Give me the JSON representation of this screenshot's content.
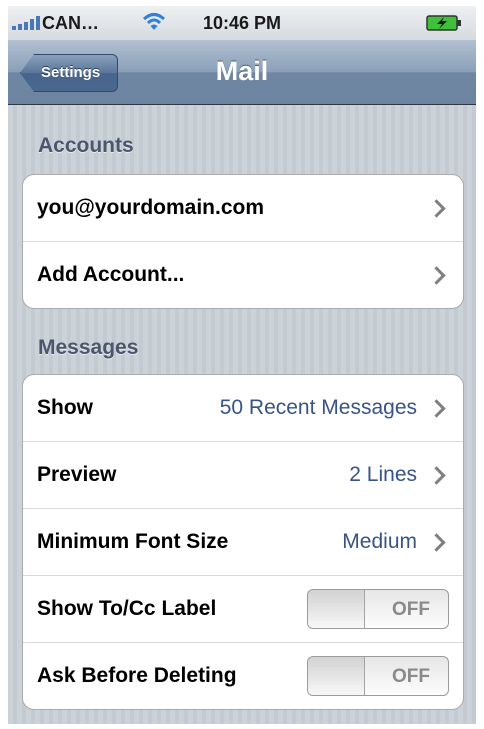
{
  "status_bar": {
    "carrier": "CAN…",
    "time": "10:46 PM",
    "icons": [
      "signal-bars-icon",
      "wifi-icon",
      "battery-charging-icon"
    ]
  },
  "nav": {
    "back_label": "Settings",
    "title": "Mail"
  },
  "accounts": {
    "header": "Accounts",
    "rows": [
      {
        "label": "you@yourdomain.com"
      },
      {
        "label": "Add Account..."
      }
    ]
  },
  "messages": {
    "header": "Messages",
    "show": {
      "label": "Show",
      "value": "50 Recent Messages"
    },
    "preview": {
      "label": "Preview",
      "value": "2 Lines"
    },
    "min_font": {
      "label": "Minimum Font Size",
      "value": "Medium"
    },
    "show_to_cc": {
      "label": "Show To/Cc Label",
      "state": "OFF"
    },
    "ask_before_deleting": {
      "label": "Ask Before Deleting",
      "state": "OFF"
    }
  },
  "colors": {
    "accent_value": "#385487",
    "nav_bar": "#7087a3",
    "background": "#c5ccd4"
  }
}
